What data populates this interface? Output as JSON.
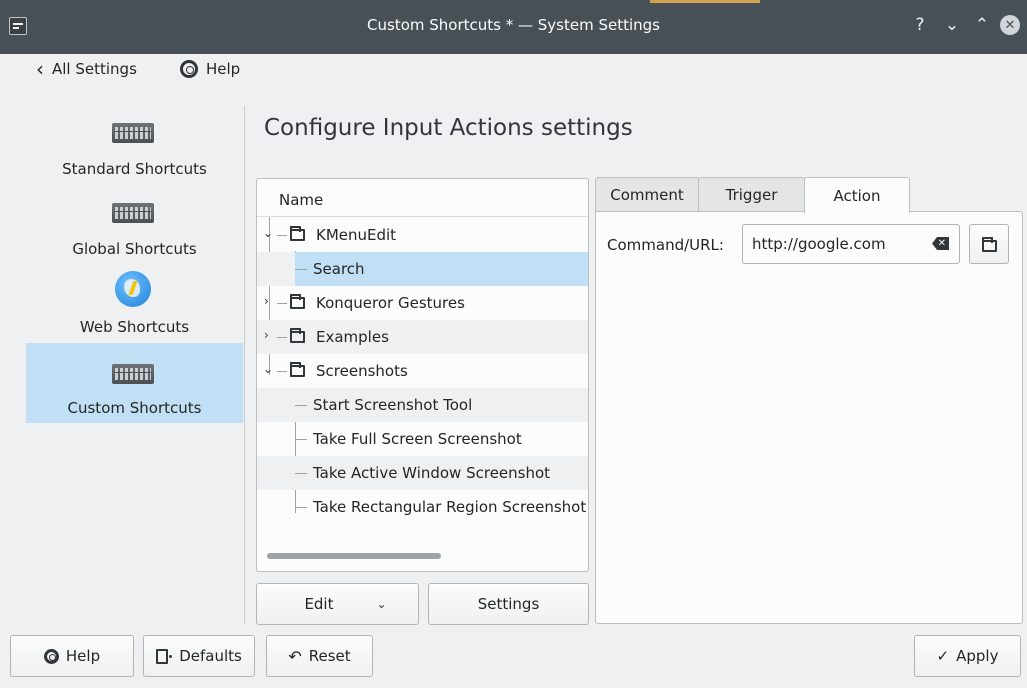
{
  "window": {
    "title": "Custom Shortcuts * — System Settings",
    "controls": {
      "help": "?",
      "minimize": "⌄",
      "maximize": "⌃",
      "close": "✕"
    }
  },
  "nav": {
    "back_label": "All Settings",
    "help_label": "Help"
  },
  "sidebar": {
    "items": [
      {
        "label": "Standard Shortcuts",
        "icon": "keyboard-icon"
      },
      {
        "label": "Global Shortcuts",
        "icon": "keyboard-icon"
      },
      {
        "label": "Web Shortcuts",
        "icon": "globe-icon"
      },
      {
        "label": "Custom Shortcuts",
        "icon": "keyboard-icon",
        "selected": true
      }
    ]
  },
  "page": {
    "title": "Configure Input Actions settings"
  },
  "tree": {
    "header": "Name",
    "rows": [
      {
        "label": "KMenuEdit",
        "type": "folder",
        "expanded": true
      },
      {
        "label": "Search",
        "type": "action",
        "selected": true
      },
      {
        "label": "Konqueror Gestures",
        "type": "folder",
        "expanded": false
      },
      {
        "label": "Examples",
        "type": "folder",
        "expanded": false
      },
      {
        "label": "Screenshots",
        "type": "folder",
        "expanded": true
      },
      {
        "label": "Start Screenshot Tool",
        "type": "action"
      },
      {
        "label": "Take Full Screen Screenshot",
        "type": "action"
      },
      {
        "label": "Take Active Window Screenshot",
        "type": "action"
      },
      {
        "label": "Take Rectangular Region Screenshot",
        "type": "action"
      }
    ]
  },
  "tree_buttons": {
    "edit": "Edit",
    "settings": "Settings"
  },
  "tabs": {
    "items": [
      "Comment",
      "Trigger",
      "Action"
    ],
    "active": "Action"
  },
  "action": {
    "command_label": "Command/URL:",
    "command_value": "http://google.com"
  },
  "footer": {
    "help": "Help",
    "defaults": "Defaults",
    "reset": "Reset",
    "apply": "Apply"
  },
  "colors": {
    "titlebar": "#475057",
    "selection": "#c2e0f5",
    "background": "#eff0f1"
  }
}
